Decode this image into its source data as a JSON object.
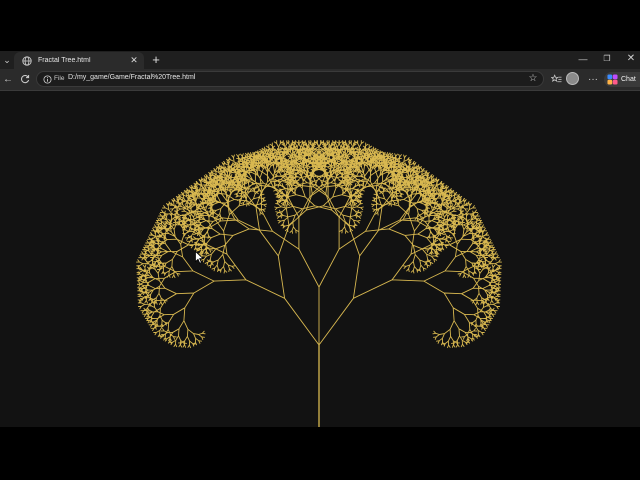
{
  "browser": {
    "tab": {
      "title": "Fractal Tree.html",
      "favicon": "globe-icon"
    },
    "address_bar": {
      "scheme_label": "File",
      "url": "D:/my_game/Game/Fractal%20Tree.html"
    },
    "chat_label": "Chat"
  },
  "canvas": {
    "background": "#121212",
    "tree_color": "#d8b850",
    "depth": 11,
    "branch_angle_deg": 28,
    "length_ratio": 0.74
  },
  "icons": {
    "tab_list": "chevron-down-icon",
    "back": "back-arrow-icon",
    "refresh": "refresh-icon",
    "favorites": "favorites-icon",
    "menu": "more-icon",
    "star": "star-icon"
  }
}
